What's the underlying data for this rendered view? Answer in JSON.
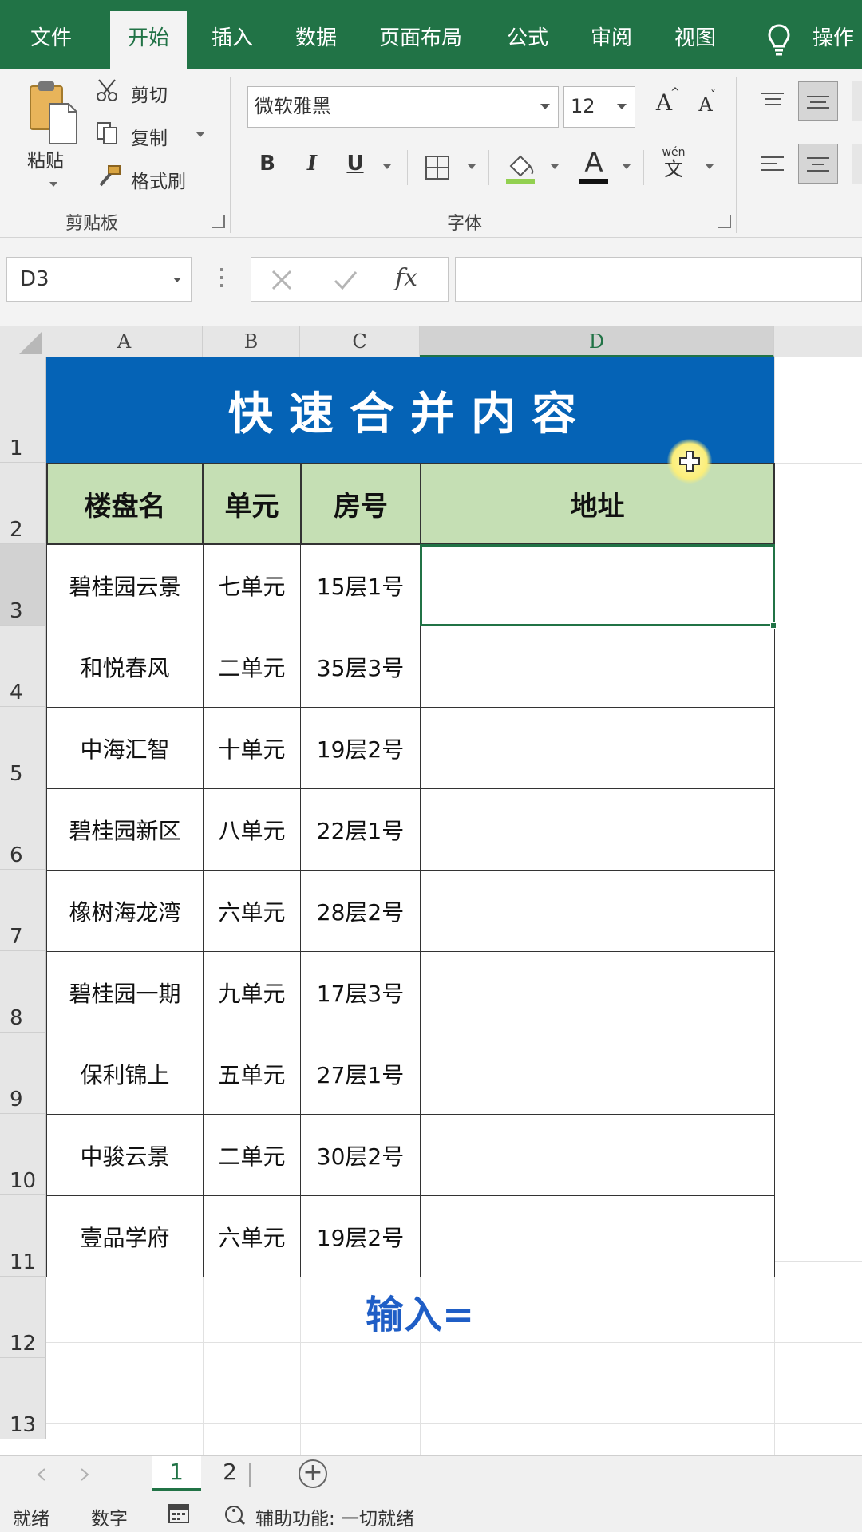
{
  "ribbon_tabs": [
    "文件",
    "开始",
    "插入",
    "数据",
    "页面布局",
    "公式",
    "审阅",
    "视图",
    "操作"
  ],
  "clipboard": {
    "paste": "粘贴",
    "cut": "剪切",
    "copy": "复制",
    "format_painter": "格式刷",
    "caption": "剪贴板"
  },
  "font": {
    "name": "微软雅黑",
    "size": "12",
    "bold": "B",
    "italic": "I",
    "underline": "U",
    "font_color_glyph": "A",
    "phonetic_top": "wén",
    "phonetic_bottom": "文",
    "caption": "字体"
  },
  "formula_bar": {
    "name_box": "D3",
    "fx": "fx",
    "content": ""
  },
  "columns": [
    "A",
    "B",
    "C",
    "D"
  ],
  "rows": [
    "1",
    "2",
    "3",
    "4",
    "5",
    "6",
    "7",
    "8",
    "9",
    "10",
    "11",
    "12",
    "13"
  ],
  "sheet": {
    "title": "快速合并内容",
    "headers": [
      "楼盘名",
      "单元",
      "房号",
      "地址"
    ],
    "records": [
      [
        "碧桂园云景",
        "七单元",
        "15层1号",
        ""
      ],
      [
        "和悦春风",
        "二单元",
        "35层3号",
        ""
      ],
      [
        "中海汇智",
        "十单元",
        "19层2号",
        ""
      ],
      [
        "碧桂园新区",
        "八单元",
        "22层1号",
        ""
      ],
      [
        "橡树海龙湾",
        "六单元",
        "28层2号",
        ""
      ],
      [
        "碧桂园一期",
        "九单元",
        "17层3号",
        ""
      ],
      [
        "保利锦上",
        "五单元",
        "27层1号",
        ""
      ],
      [
        "中骏云景",
        "二单元",
        "30层2号",
        ""
      ],
      [
        "壹品学府",
        "六单元",
        "19层2号",
        ""
      ]
    ],
    "note": "输入="
  },
  "sheet_tabs": [
    "1",
    "2"
  ],
  "status": {
    "ready": "就绪",
    "numlock": "数字",
    "accessibility": "辅助功能: 一切就绪"
  },
  "colors": {
    "accent": "#217346",
    "title_fill": "#0563b6",
    "header_fill": "#c5dfb4",
    "note_text": "#1f5ec6"
  }
}
